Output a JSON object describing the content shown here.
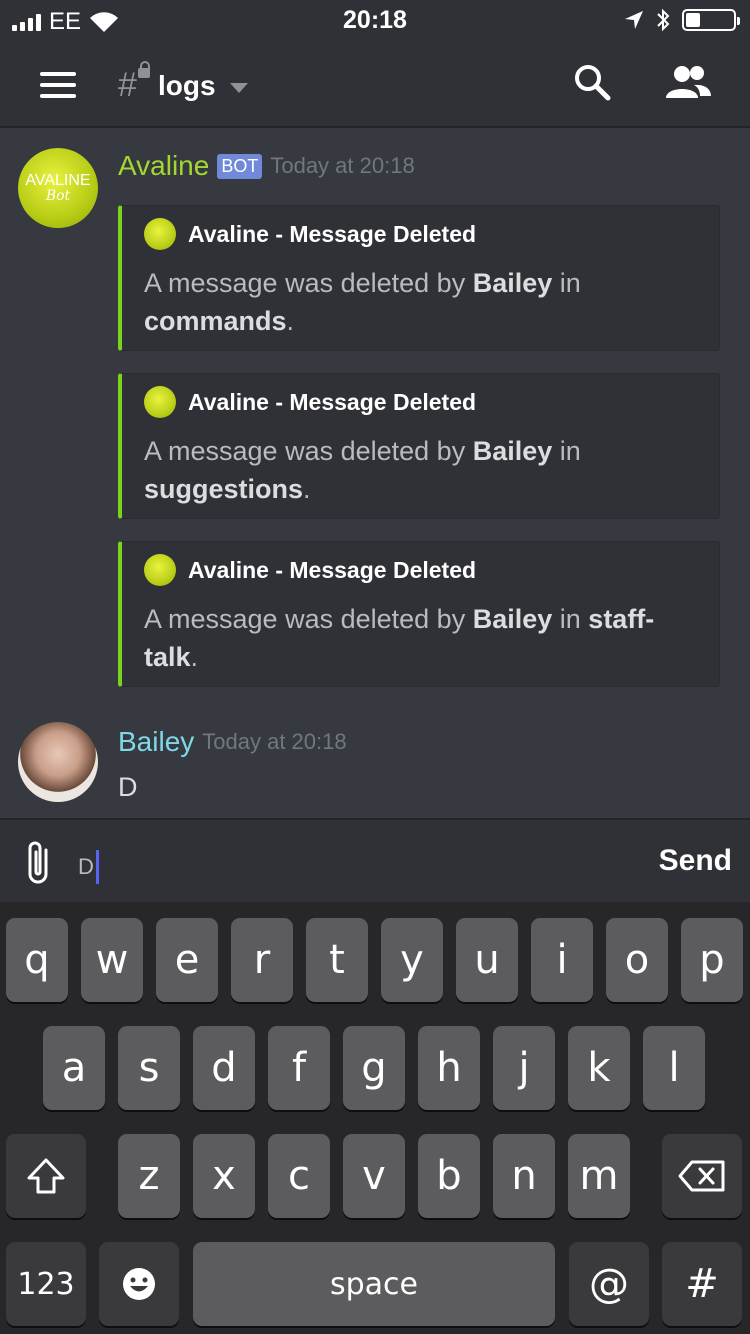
{
  "status": {
    "carrier": "EE",
    "time": "20:18"
  },
  "header": {
    "channel": "logs"
  },
  "bot_message": {
    "author": "Avaline",
    "badge": "BOT",
    "timestamp": "Today at 20:18",
    "avatar_text": [
      "AVALINE",
      "Bot"
    ],
    "accent_color": "#7bd41c",
    "embeds": [
      {
        "title": "Avaline - Message Deleted",
        "prefix": "A message was deleted by ",
        "user": "Bailey",
        "middle": " in ",
        "channel": "commands",
        "suffix": "."
      },
      {
        "title": "Avaline - Message Deleted",
        "prefix": "A message was deleted by ",
        "user": "Bailey",
        "middle": " in ",
        "channel": "suggestions",
        "suffix": "."
      },
      {
        "title": "Avaline - Message Deleted",
        "prefix": "A message was deleted by ",
        "user": "Bailey",
        "middle": " in ",
        "channel": "staff-talk",
        "suffix": "."
      }
    ]
  },
  "user_message": {
    "author": "Bailey",
    "timestamp": "Today at 20:18",
    "text": "D",
    "name_color": "#7fd8e8"
  },
  "composer": {
    "value": "D",
    "send_label": "Send"
  },
  "keyboard": {
    "row1": [
      "q",
      "w",
      "e",
      "r",
      "t",
      "y",
      "u",
      "i",
      "o",
      "p"
    ],
    "row2": [
      "a",
      "s",
      "d",
      "f",
      "g",
      "h",
      "j",
      "k",
      "l"
    ],
    "row3": [
      "z",
      "x",
      "c",
      "v",
      "b",
      "n",
      "m"
    ],
    "numbers_label": "123",
    "space_label": "space",
    "at_label": "@",
    "hash_label": "#"
  }
}
